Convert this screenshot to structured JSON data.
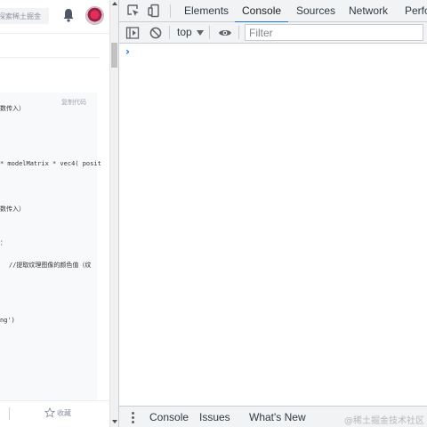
{
  "webpage": {
    "search_placeholder": "探索稀土掘金",
    "code": {
      "copy_label": "复制代码",
      "lines": [
        "数传入）",
        "* modelMatrix * vec4( posit",
        "数传入）",
        "：",
        "//提取纹理图像的颜色值（纹",
        "ng')"
      ]
    },
    "footer": {
      "favorite_label": "收藏"
    }
  },
  "devtools": {
    "tabs": [
      "Elements",
      "Console",
      "Sources",
      "Network",
      "Perfor"
    ],
    "active_tab": "Console",
    "toolbar": {
      "context": "top",
      "filter_placeholder": "Filter"
    },
    "console": {
      "prompt": "›"
    },
    "drawer": {
      "tabs": [
        "Console",
        "Issues",
        "What's New"
      ],
      "active_tab": "Console"
    },
    "watermark": "@稀土掘金技术社区",
    "accent_color": "#1a73e8"
  }
}
